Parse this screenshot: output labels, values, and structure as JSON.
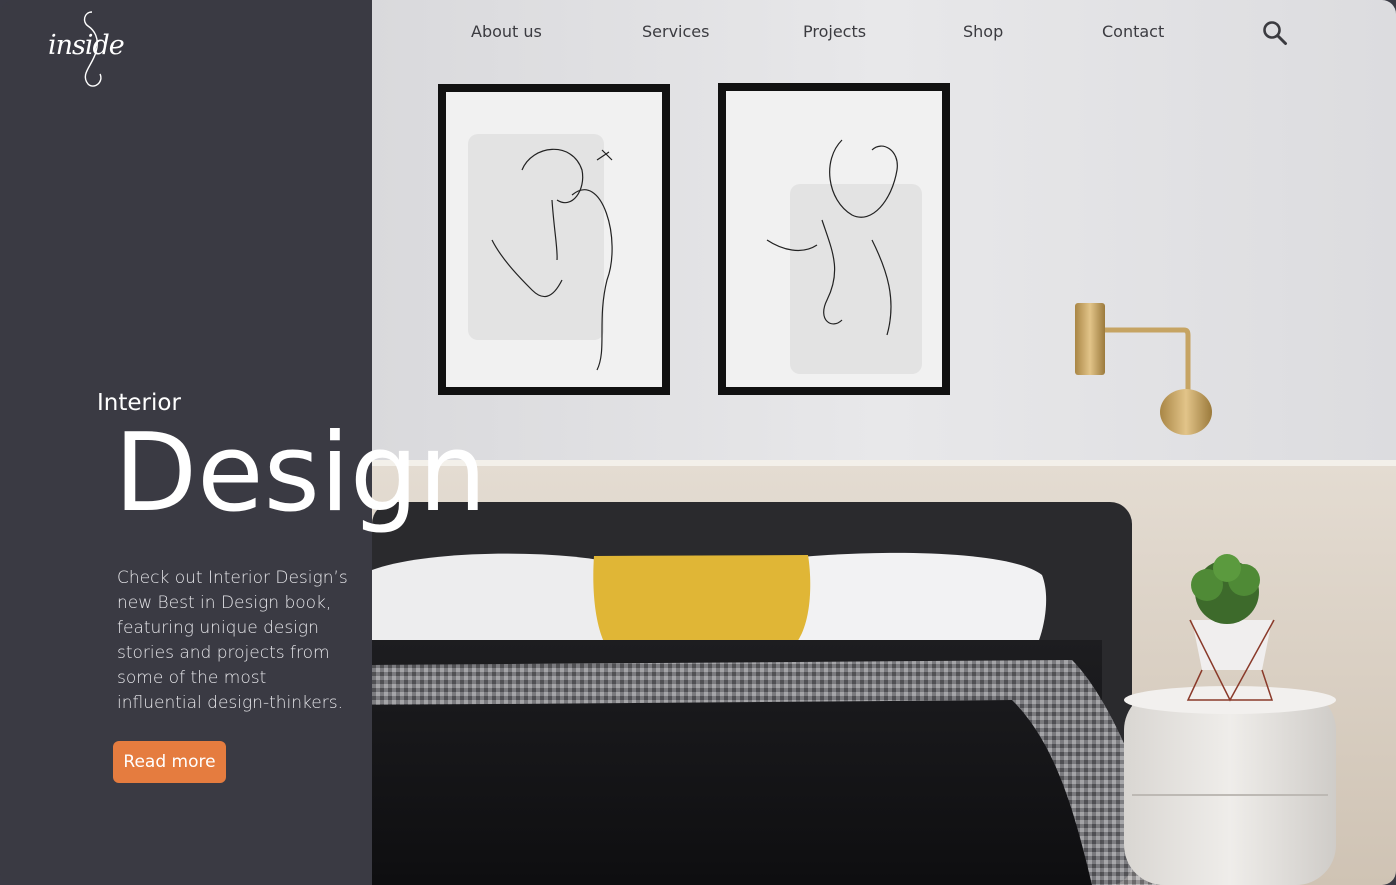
{
  "brand": {
    "logo_text": "inside",
    "logo_icon": "inside-logo-icon"
  },
  "nav": {
    "items": [
      {
        "label": "About us"
      },
      {
        "label": "Services"
      },
      {
        "label": "Projects"
      },
      {
        "label": "Shop"
      },
      {
        "label": "Contact"
      }
    ],
    "search_icon": "search-icon"
  },
  "hero": {
    "eyebrow": "Interior",
    "title": "Design",
    "description": "Check out Interior Design’s new Best in Design book, featuring unique design stories and projects from some of the most influential design-thinkers.",
    "cta_label": "Read more"
  },
  "colors": {
    "panel": "#3a3a43",
    "accent": "#e57c3f",
    "nav_text": "#3b3b40"
  }
}
